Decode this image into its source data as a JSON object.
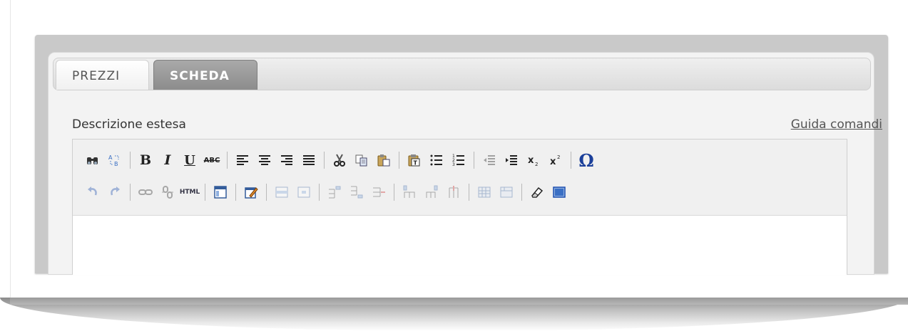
{
  "tabs": [
    {
      "label": "PREZZI",
      "active": false
    },
    {
      "label": "SCHEDA",
      "active": true
    }
  ],
  "editor": {
    "field_label": "Descrizione estesa",
    "help_link": "Guida comandi",
    "content": ""
  },
  "toolbar_labels": {
    "bold": "B",
    "italic": "I",
    "underline": "U",
    "strike": "ABC",
    "html": "HTML",
    "special_char": "Ω"
  },
  "toolbar_row1_icons": [
    "find-icon",
    "replace-icon",
    "bold-icon",
    "italic-icon",
    "underline-icon",
    "strikethrough-icon",
    "align-left-icon",
    "align-center-icon",
    "align-right-icon",
    "align-justify-icon",
    "cut-icon",
    "copy-icon",
    "paste-icon",
    "paste-text-icon",
    "bullet-list-icon",
    "numbered-list-icon",
    "outdent-icon",
    "indent-icon",
    "subscript-icon",
    "superscript-icon",
    "special-char-icon"
  ],
  "toolbar_row2_icons": [
    "undo-icon",
    "redo-icon",
    "link-icon",
    "unlink-icon",
    "html-source-icon",
    "template-icon",
    "edit-icon",
    "table-row-props-icon",
    "table-cell-props-icon",
    "insert-row-before-icon",
    "insert-row-after-icon",
    "delete-row-icon",
    "insert-col-before-icon",
    "insert-col-after-icon",
    "delete-col-icon",
    "split-cells-icon",
    "merge-cells-icon",
    "cleanup-icon",
    "visual-aid-icon"
  ],
  "colors": {
    "frame": "#c9c9c9",
    "active_tab": "#9a9a9a",
    "omega": "#1b3f9a",
    "toolbar_bg": "#f0f0f0"
  }
}
